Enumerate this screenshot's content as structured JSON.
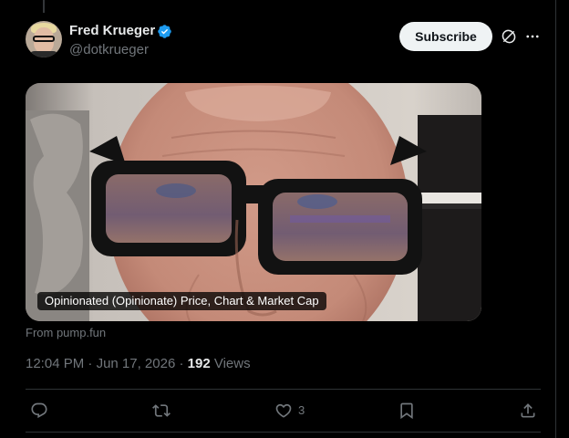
{
  "post": {
    "author": {
      "display_name": "Fred Krueger",
      "handle": "@dotkrueger",
      "verified": true
    },
    "subscribe_label": "Subscribe",
    "card": {
      "title": "Opinionated (Opinionate) Price, Chart & Market Cap",
      "source": "From pump.fun"
    },
    "meta": {
      "time": "12:04 PM",
      "separator": "·",
      "date": "Jun 17, 2026",
      "views_count": "192",
      "views_label": "Views"
    },
    "actions": {
      "like_count": "3"
    }
  },
  "colors": {
    "background": "#000000",
    "text_primary": "#e7e9ea",
    "text_secondary": "#71767b",
    "verified_badge": "#1d9bf0",
    "subscribe_bg": "#eff3f4",
    "divider": "#2f3336"
  },
  "icons": {
    "verified": "verified-badge-icon",
    "grok": "grok-icon",
    "more": "more-horizontal-icon",
    "reply": "reply-icon",
    "repost": "repost-icon",
    "like": "heart-icon",
    "bookmark": "bookmark-icon",
    "share": "share-icon"
  }
}
